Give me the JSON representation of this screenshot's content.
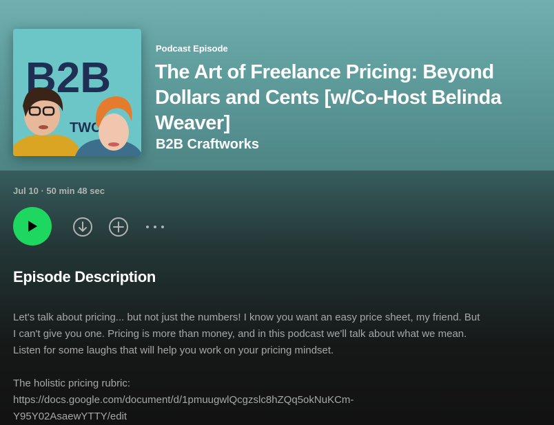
{
  "episode": {
    "type_label": "Podcast Episode",
    "title": "The Art of Freelance Pricing: Beyond Dollars and Cents [w/Co-Host Belinda Weaver]",
    "show_name": "B2B Craftworks",
    "meta": "Jul 10 · 50 min 48 sec",
    "cover_text": "B2B",
    "cover_text_small": "TWO"
  },
  "actions": {
    "play": "play-icon",
    "download": "download-icon",
    "add": "add-icon",
    "more": "more-icon"
  },
  "description": {
    "heading": "Episode Description",
    "paragraph": "Let's talk about pricing... but not just the numbers! I know you want an easy price sheet, my friend. But I can't give you one. Pricing is more than money, and in this podcast we'll talk about what we mean. Listen for some laughs that will help you work on your pricing mindset.",
    "rubric_label": "The holistic pricing rubric:",
    "rubric_link_line1": "https://docs.google.com/document/d/1pmuugwlQcgzslc8hZQq5okNuKCm-",
    "rubric_link_line2": "Y95Y02AsaewYTTY/edit"
  },
  "colors": {
    "accent": "#1ed760",
    "hero": "#6fb0b0",
    "background": "#121212",
    "muted_text": "#a7a7a7"
  }
}
